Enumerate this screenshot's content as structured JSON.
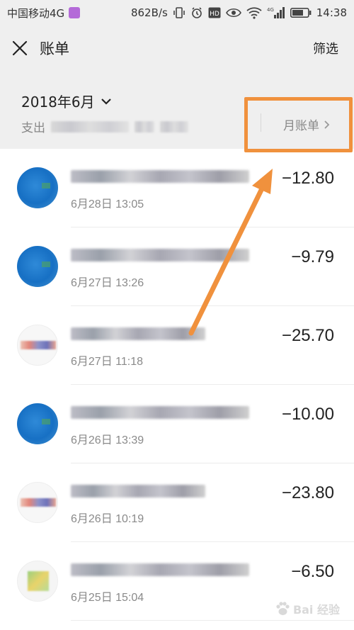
{
  "status_bar": {
    "carrier": "中国移动4G",
    "speed": "862B/s",
    "time": "14:38",
    "icons": [
      "image-icon",
      "vibrate-icon",
      "alarm-icon",
      "hd-icon",
      "eye-icon",
      "wifi-icon",
      "signal-4g-icon",
      "battery-icon"
    ]
  },
  "header": {
    "title": "账单",
    "filter_label": "筛选",
    "close_icon": "close-icon"
  },
  "summary": {
    "month_label": "2018年6月",
    "spend_label": "支出",
    "monthly_bill_label": "月账单"
  },
  "transactions": [
    {
      "date": "6月28日 13:05",
      "amount": "−12.80",
      "avatar": "blue"
    },
    {
      "date": "6月27日 13:26",
      "amount": "−9.79",
      "avatar": "blue"
    },
    {
      "date": "6月27日 11:18",
      "amount": "−25.70",
      "avatar": "red"
    },
    {
      "date": "6月26日 13:39",
      "amount": "−10.00",
      "avatar": "blue"
    },
    {
      "date": "6月26日 10:19",
      "amount": "−23.80",
      "avatar": "red"
    },
    {
      "date": "6月25日 15:04",
      "amount": "−6.50",
      "avatar": "green"
    }
  ],
  "annotation": {
    "color": "#f0913d"
  },
  "watermark": {
    "text": "Bai 经验"
  }
}
